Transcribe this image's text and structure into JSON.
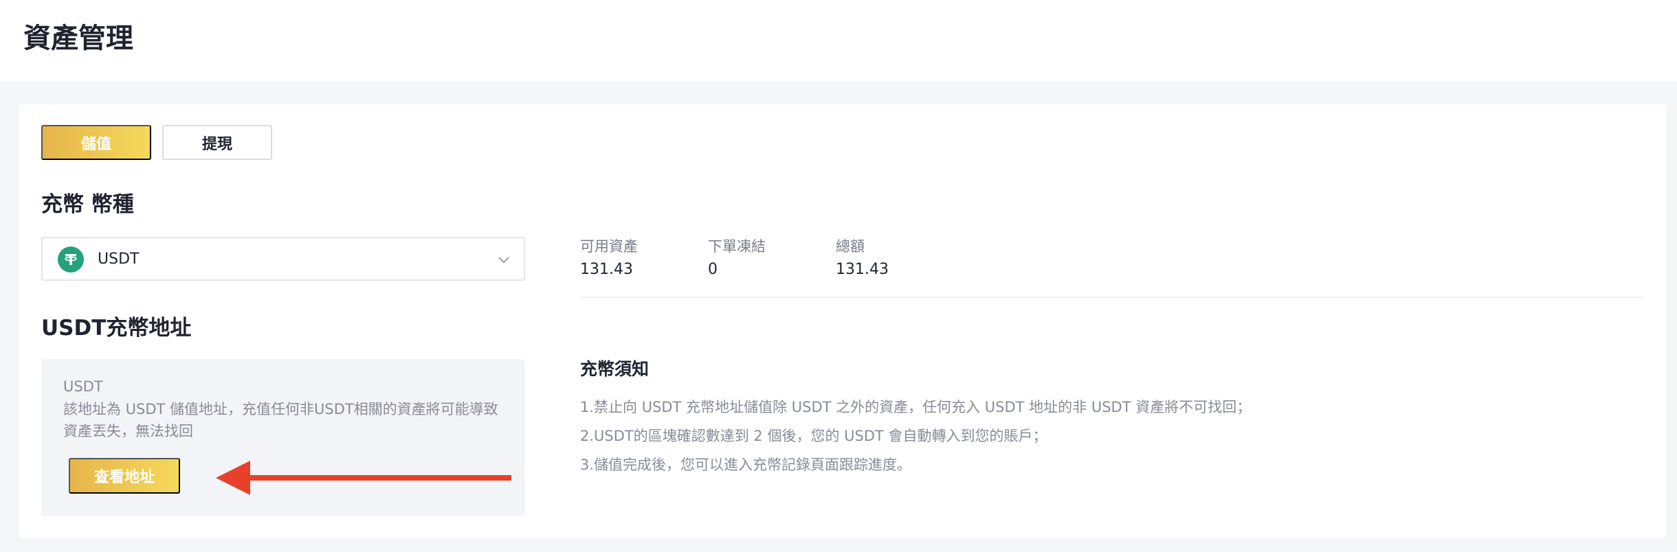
{
  "header": {
    "title": "資產管理"
  },
  "tabs": {
    "deposit": "儲值",
    "withdraw": "提現"
  },
  "coin_section": {
    "title": "充幣 幣種",
    "selected_coin": "USDT",
    "icon": "tether-icon"
  },
  "stats": [
    {
      "label": "可用資產",
      "value": "131.43"
    },
    {
      "label": "下單凍結",
      "value": "0"
    },
    {
      "label": "總額",
      "value": "131.43"
    }
  ],
  "address_section": {
    "title": "USDT充幣地址",
    "coin": "USDT",
    "description": "該地址為 USDT 儲值地址，充值任何非USDT相關的資產將可能導致資產丟失，無法找回",
    "view_button": "查看地址"
  },
  "notice": {
    "title": "充幣須知",
    "items": [
      "1.禁止向 USDT 充幣地址儲值除 USDT 之外的資產，任何充入 USDT 地址的非 USDT 資產將不可找回；",
      "2.USDT的區塊確認數達到 2 個後，您的 USDT 會自動轉入到您的賬戶；",
      "3.儲值完成後，您可以進入充幣記錄頁面跟踪進度。"
    ]
  },
  "colors": {
    "accent_gradient_start": "#e6b54a",
    "accent_gradient_end": "#f4d95a",
    "tether_green": "#26a17b",
    "annotation_arrow": "#e8402a"
  }
}
